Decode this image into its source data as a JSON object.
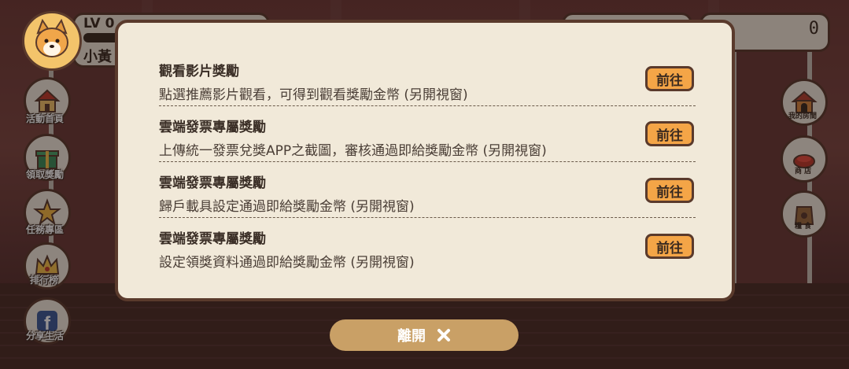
{
  "hud": {
    "level": "LV 0",
    "player_name": "小黃",
    "coins_value": "0"
  },
  "left_menu": [
    {
      "label": "活動首頁",
      "icon": "house-icon"
    },
    {
      "label": "領取獎勵",
      "icon": "gift-box-icon"
    },
    {
      "label": "任務專區",
      "icon": "star-icon"
    },
    {
      "label": "排行榜",
      "icon": "crown-icon"
    },
    {
      "label": "分享生活",
      "icon": "facebook-icon"
    }
  ],
  "right_menu": [
    {
      "label": "我的房間",
      "icon": "doghouse-icon"
    },
    {
      "label": "商 店",
      "icon": "shop-icon"
    },
    {
      "label": "糧 食",
      "icon": "food-bag-icon"
    }
  ],
  "dialog": {
    "rows": [
      {
        "title": "觀看影片獎勵",
        "desc": "點選推薦影片觀看，可得到觀看獎勵金幣 (另開視窗)",
        "button": "前往"
      },
      {
        "title": "雲端發票專屬獎勵",
        "desc": "上傳統一發票兌獎APP之截圖，審核通過即給獎勵金幣 (另開視窗)",
        "button": "前往"
      },
      {
        "title": "雲端發票專屬獎勵",
        "desc": "歸戶載具設定通過即給獎勵金幣 (另開視窗)",
        "button": "前往"
      },
      {
        "title": "雲端發票專屬獎勵",
        "desc": "設定領獎資料通過即給獎勵金幣 (另開視窗)",
        "button": "前往"
      }
    ]
  },
  "leave_button": {
    "label": "離開",
    "icon": "close-x-icon"
  }
}
